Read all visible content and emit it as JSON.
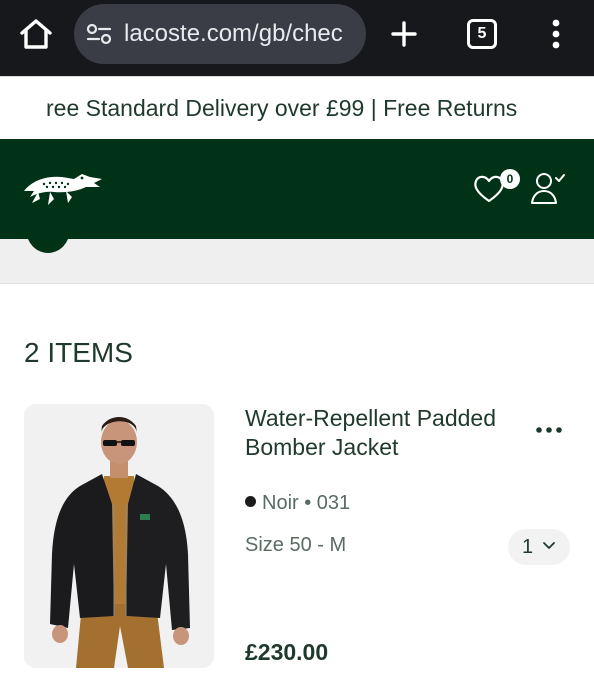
{
  "browser": {
    "url": "lacoste.com/gb/chec",
    "tab_count": "5",
    "icons": [
      "home-icon",
      "site-settings-icon",
      "plus-icon",
      "tab-switcher-icon",
      "more-vert-icon"
    ]
  },
  "promo": {
    "text": "ree Standard Delivery over £99 | Free Returns"
  },
  "header": {
    "logo": "crocodile-logo-icon",
    "wishlist_count": "0",
    "icons": [
      "heart-icon",
      "user-icon"
    ]
  },
  "cart": {
    "title": "2 ITEMS",
    "items": [
      {
        "name": "Water-Repellent Padded Bomber Jacket",
        "color": "Noir",
        "color_code": "031",
        "size": "Size 50 - M",
        "quantity": "1",
        "price": "£230.00"
      }
    ]
  },
  "colors": {
    "brand_green": "#003218",
    "text_green": "#1f3a2c",
    "chrome_dark": "#16181c"
  }
}
